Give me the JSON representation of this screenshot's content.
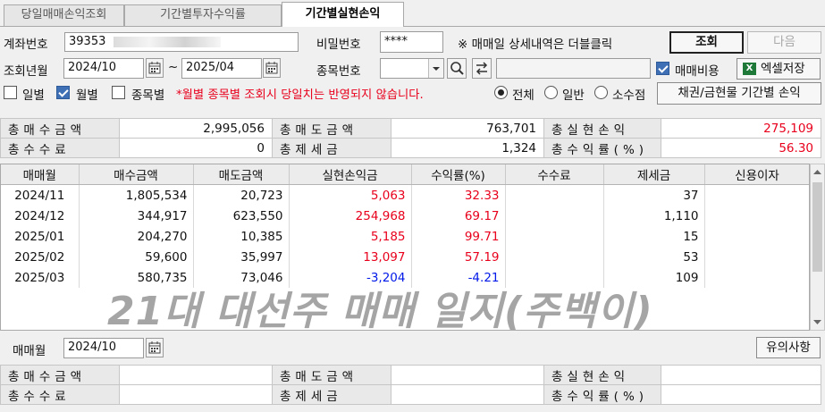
{
  "tabs": [
    "당일매매손익조회",
    "기간별투자수익률",
    "기간별실현손익"
  ],
  "form": {
    "account_label": "계좌번호",
    "account_value": "39353",
    "password_label": "비밀번호",
    "password_value": "****",
    "notice": "※ 매매일 상세내역은 더블클릭",
    "query_button": "조회",
    "next_button": "다음",
    "period_label": "조회년월",
    "period_from": "2024/10",
    "period_sep": "~",
    "period_to": "2025/04",
    "stock_label": "종목번호",
    "trade_cost_label": "매매비용",
    "excel_button": "엑셀저장",
    "daily_label": "일별",
    "monthly_label": "월별",
    "stock_wise_label": "종목별",
    "warning": "*월별 종목별 조회시 당일치는 반영되지 않습니다.",
    "radio_all": "전체",
    "radio_general": "일반",
    "radio_fraction": "소수점",
    "bond_button": "채권/금현물 기간별 손익"
  },
  "summary": {
    "buy_label": "총매수금액",
    "buy_value": "2,995,056",
    "sell_label": "총매도금액",
    "sell_value": "763,701",
    "realized_label": "총실현손익",
    "realized_value": "275,109",
    "fee_label": "총수수료",
    "fee_value": "0",
    "tax_label": "총제세금",
    "tax_value": "1,324",
    "rate_label": "총수익률(%)",
    "rate_value": "56.30"
  },
  "grid": {
    "columns": [
      "매매월",
      "매수금액",
      "매도금액",
      "실현손익금",
      "수익률(%)",
      "수수료",
      "제세금",
      "신용이자"
    ],
    "rows": [
      {
        "month": "2024/11",
        "buy": "1,805,534",
        "sell": "20,723",
        "pnl": "5,063",
        "rate": "32.33",
        "fee": "",
        "tax": "37",
        "interest": ""
      },
      {
        "month": "2024/12",
        "buy": "344,917",
        "sell": "623,550",
        "pnl": "254,968",
        "rate": "69.17",
        "fee": "",
        "tax": "1,110",
        "interest": ""
      },
      {
        "month": "2025/01",
        "buy": "204,270",
        "sell": "10,385",
        "pnl": "5,185",
        "rate": "99.71",
        "fee": "",
        "tax": "15",
        "interest": ""
      },
      {
        "month": "2025/02",
        "buy": "59,600",
        "sell": "35,997",
        "pnl": "13,097",
        "rate": "57.19",
        "fee": "",
        "tax": "53",
        "interest": ""
      },
      {
        "month": "2025/03",
        "buy": "580,735",
        "sell": "73,046",
        "pnl": "-3,204",
        "rate": "-4.21",
        "fee": "",
        "tax": "109",
        "interest": ""
      }
    ]
  },
  "overlay_text": "21대 대선주 매매 일지(주백이)",
  "bottom": {
    "month_label": "매매월",
    "month_value": "2024/10",
    "notice_button": "유의사항",
    "buy_label": "총매수금액",
    "sell_label": "총매도금액",
    "realized_label": "총실현손익",
    "fee_label": "총수수료",
    "tax_label": "총제세금",
    "rate_label": "총수익률(%)"
  },
  "colors": {
    "positive": "#e8001c",
    "negative": "#0018e8",
    "excel_icon": "#1f7a3a"
  },
  "icons": {
    "calendar": "calendar-icon",
    "search": "search-icon",
    "swap": "swap-icon",
    "dropdown": "chevron-down-icon",
    "excel": "excel-icon"
  }
}
